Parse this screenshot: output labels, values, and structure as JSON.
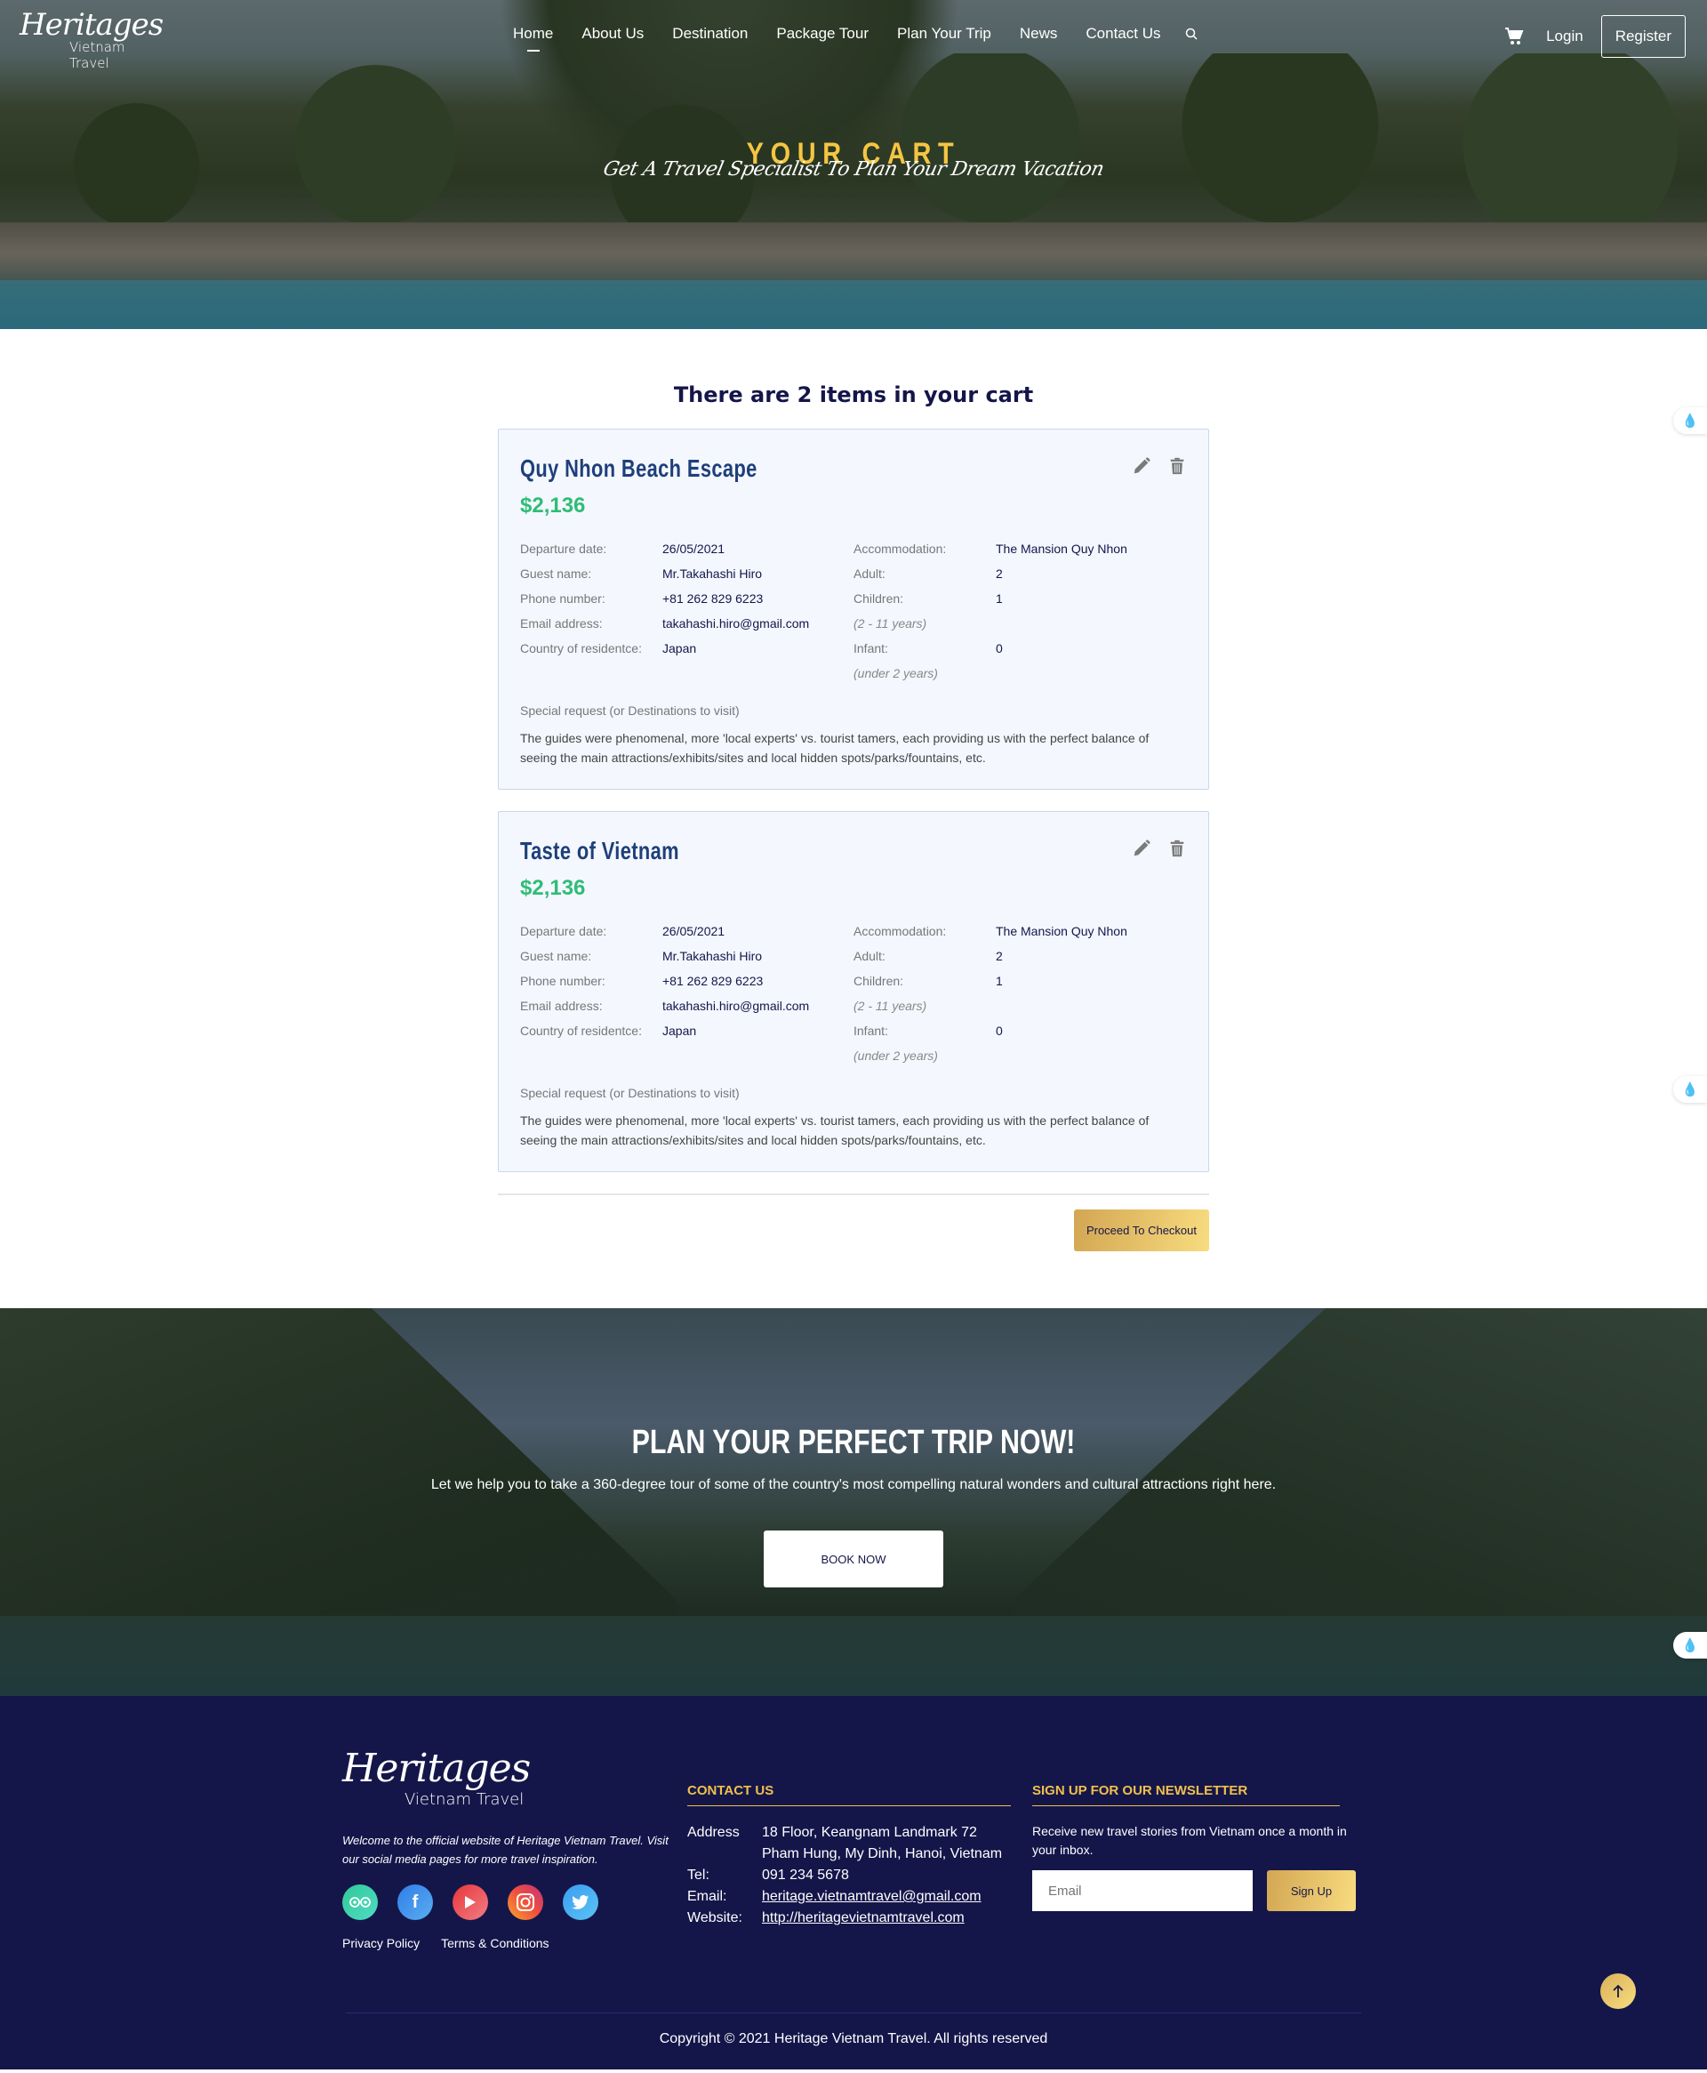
{
  "brand": {
    "script": "Heritages",
    "sub": "Vietnam Travel"
  },
  "nav": {
    "items": [
      {
        "label": "Home",
        "active": true
      },
      {
        "label": "About Us"
      },
      {
        "label": "Destination"
      },
      {
        "label": "Package Tour"
      },
      {
        "label": "Plan Your Trip"
      },
      {
        "label": "News"
      },
      {
        "label": "Contact Us"
      }
    ],
    "search_icon": "search-icon",
    "cart_icon": "shopping-cart-icon",
    "login": "Login",
    "register": "Register"
  },
  "hero": {
    "title": "YOUR CART",
    "subtitle": "Get A Travel Specialist To Plan Your Dream Vacation"
  },
  "cart": {
    "heading": "There are 2 items in your cart",
    "labels": {
      "departure": "Departure date:",
      "guest": "Guest name:",
      "phone": "Phone number:",
      "email": "Email address:",
      "country": "Country of residentce:",
      "accommodation": "Accommodation:",
      "adult": "Adult:",
      "children": "Children:",
      "children_note": "(2 - 11 years)",
      "infant": "Infant:",
      "infant_note": "(under 2 years)",
      "special": "Special request (or Destinations to visit)"
    },
    "items": [
      {
        "title": "Quy Nhon Beach Escape",
        "price": "$2,136",
        "departure": "26/05/2021",
        "guest": "Mr.Takahashi Hiro",
        "phone": "+81 262 829 6223",
        "email": "takahashi.hiro@gmail.com",
        "country": "Japan",
        "accommodation": "The Mansion Quy Nhon",
        "adult": "2",
        "children": "1",
        "infant": "0",
        "special": "The guides were phenomenal, more 'local experts' vs. tourist tamers, each providing us with the perfect balance of seeing the main attractions/exhibits/sites and local hidden spots/parks/fountains, etc."
      },
      {
        "title": "Taste of Vietnam",
        "price": "$2,136",
        "departure": "26/05/2021",
        "guest": "Mr.Takahashi Hiro",
        "phone": "+81 262 829 6223",
        "email": "takahashi.hiro@gmail.com",
        "country": "Japan",
        "accommodation": "The Mansion Quy Nhon",
        "adult": "2",
        "children": "1",
        "infant": "0",
        "special": "The guides were phenomenal, more 'local experts' vs. tourist tamers, each providing us with the perfect balance of seeing the main attractions/exhibits/sites and local hidden spots/parks/fountains, etc."
      }
    ],
    "checkout": "Proceed To Checkout"
  },
  "cta": {
    "title": "PLAN YOUR PERFECT TRIP NOW!",
    "text": "Let we help you to take a 360-degree tour of some of the country's most compelling natural wonders and cultural attractions right here.",
    "button": "BOOK NOW"
  },
  "footer": {
    "welcome": "Welcome to the official website of Heritage Vietnam Travel. Visit our social media pages for more travel inspiration.",
    "socials": [
      "tripadvisor-icon",
      "facebook-icon",
      "youtube-icon",
      "instagram-icon",
      "twitter-icon"
    ],
    "privacy": "Privacy Policy",
    "terms": "Terms & Conditions",
    "contact_heading": "CONTACT US",
    "contact": {
      "address_label": "Address",
      "address_line1": "18 Floor, Keangnam Landmark 72",
      "address_line2": "Pham Hung, My Dinh, Hanoi, Vietnam",
      "tel_label": "Tel:",
      "tel": "091 234 5678",
      "email_label": "Email:",
      "email": "heritage.vietnamtravel@gmail.com",
      "website_label": "Website:",
      "website": "http://heritagevietnamtravel.com"
    },
    "newsletter_heading": "SIGN UP FOR OUR NEWSLETTER",
    "newsletter_text": "Receive new travel stories from Vietnam once a month in your inbox.",
    "email_placeholder": "Email",
    "signup": "Sign Up",
    "copyright": "Copyright © 2021 Heritage Vietnam Travel. All rights reserved"
  },
  "colors": {
    "navy": "#14164a",
    "gold": "#f1c04a",
    "price_green": "#2ebd76",
    "card_bg": "#f4f7fe",
    "title_blue": "#1e3f7a"
  }
}
